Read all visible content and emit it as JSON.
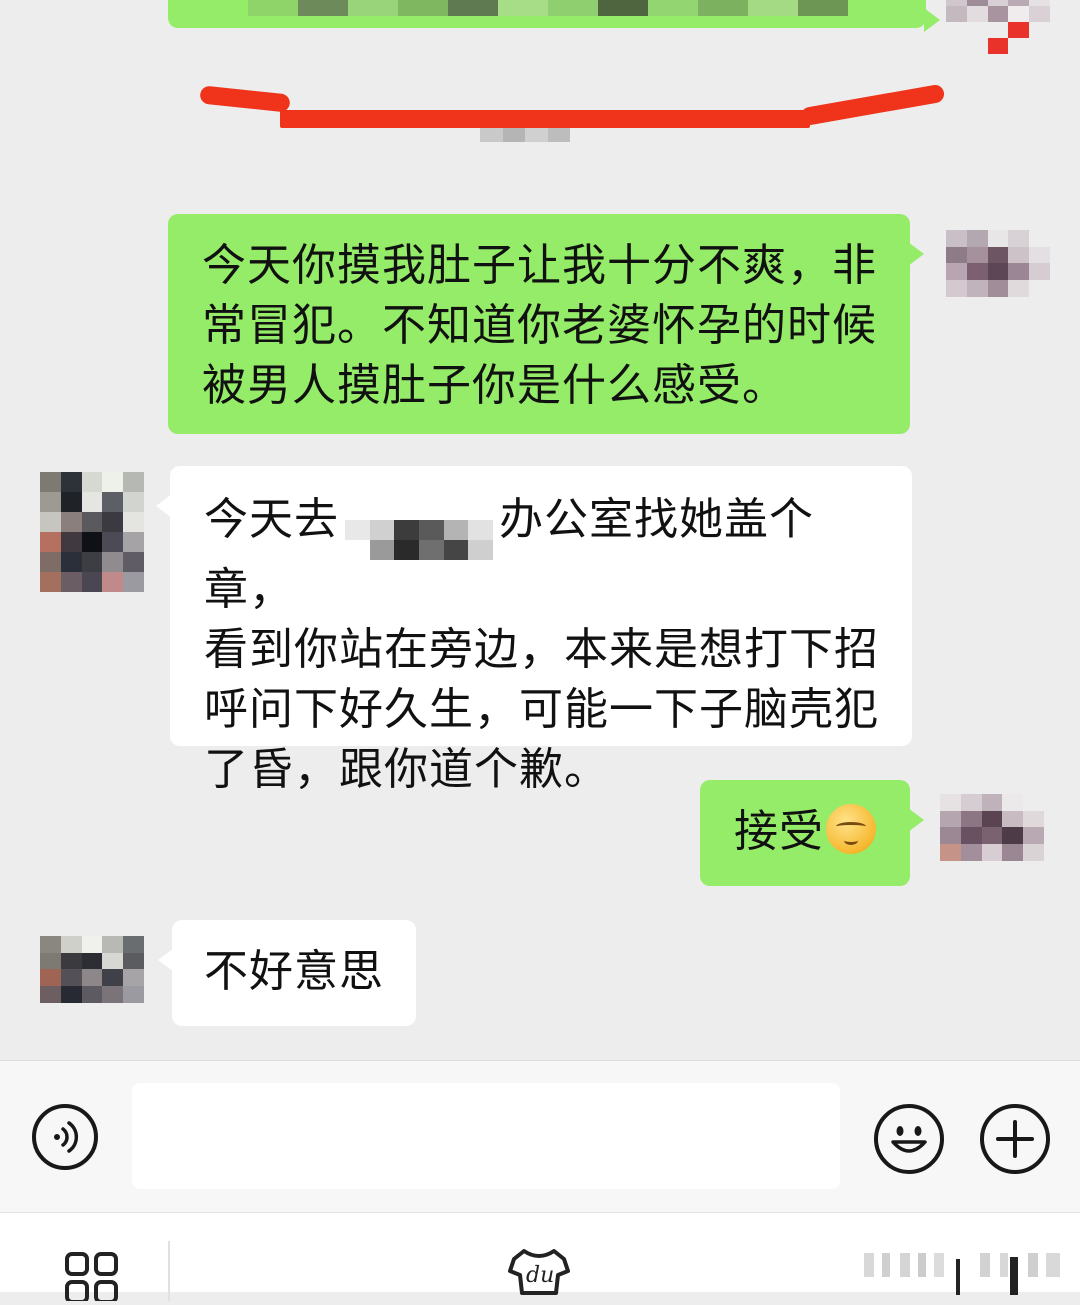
{
  "chat": {
    "messages": [
      {
        "side": "right",
        "text_lines": [
          "今天你摸我肚子让我十分不爽，非",
          "常冒犯。不知道你老婆怀孕的时候",
          "被男人摸肚子你是什么感受。"
        ]
      },
      {
        "side": "left",
        "text_lines": [
          "今天去",
          "办公室找她盖个章，",
          "看到你站在旁边，本来是想打下招",
          "呼问下好久生，可能一下子脑壳犯",
          "了昏，跟你道个歉。"
        ]
      },
      {
        "side": "right",
        "text": "接受",
        "emoji": "smirk-emoji"
      },
      {
        "side": "left",
        "text": "不好意思"
      }
    ]
  },
  "input_bar": {
    "voice_icon": "voice-icon",
    "emoji_icon": "smiley-icon",
    "plus_icon": "plus-icon"
  },
  "bottom_nav": {
    "icons": [
      "grid-icon",
      "shirt-logo-icon",
      "signal-bars-icon"
    ],
    "shirt_logo_text": "du"
  },
  "colors": {
    "background": "#ededed",
    "bubble_sent": "#95ec69",
    "bubble_received": "#ffffff",
    "annotation_red": "#f0341c"
  }
}
